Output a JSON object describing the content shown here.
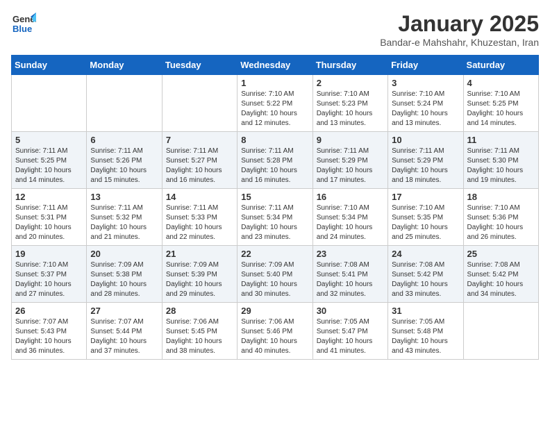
{
  "header": {
    "logo_general": "General",
    "logo_blue": "Blue",
    "month_title": "January 2025",
    "subtitle": "Bandar-e Mahshahr, Khuzestan, Iran"
  },
  "weekdays": [
    "Sunday",
    "Monday",
    "Tuesday",
    "Wednesday",
    "Thursday",
    "Friday",
    "Saturday"
  ],
  "weeks": [
    [
      {
        "day": "",
        "info": ""
      },
      {
        "day": "",
        "info": ""
      },
      {
        "day": "",
        "info": ""
      },
      {
        "day": "1",
        "info": "Sunrise: 7:10 AM\nSunset: 5:22 PM\nDaylight: 10 hours\nand 12 minutes."
      },
      {
        "day": "2",
        "info": "Sunrise: 7:10 AM\nSunset: 5:23 PM\nDaylight: 10 hours\nand 13 minutes."
      },
      {
        "day": "3",
        "info": "Sunrise: 7:10 AM\nSunset: 5:24 PM\nDaylight: 10 hours\nand 13 minutes."
      },
      {
        "day": "4",
        "info": "Sunrise: 7:10 AM\nSunset: 5:25 PM\nDaylight: 10 hours\nand 14 minutes."
      }
    ],
    [
      {
        "day": "5",
        "info": "Sunrise: 7:11 AM\nSunset: 5:25 PM\nDaylight: 10 hours\nand 14 minutes."
      },
      {
        "day": "6",
        "info": "Sunrise: 7:11 AM\nSunset: 5:26 PM\nDaylight: 10 hours\nand 15 minutes."
      },
      {
        "day": "7",
        "info": "Sunrise: 7:11 AM\nSunset: 5:27 PM\nDaylight: 10 hours\nand 16 minutes."
      },
      {
        "day": "8",
        "info": "Sunrise: 7:11 AM\nSunset: 5:28 PM\nDaylight: 10 hours\nand 16 minutes."
      },
      {
        "day": "9",
        "info": "Sunrise: 7:11 AM\nSunset: 5:29 PM\nDaylight: 10 hours\nand 17 minutes."
      },
      {
        "day": "10",
        "info": "Sunrise: 7:11 AM\nSunset: 5:29 PM\nDaylight: 10 hours\nand 18 minutes."
      },
      {
        "day": "11",
        "info": "Sunrise: 7:11 AM\nSunset: 5:30 PM\nDaylight: 10 hours\nand 19 minutes."
      }
    ],
    [
      {
        "day": "12",
        "info": "Sunrise: 7:11 AM\nSunset: 5:31 PM\nDaylight: 10 hours\nand 20 minutes."
      },
      {
        "day": "13",
        "info": "Sunrise: 7:11 AM\nSunset: 5:32 PM\nDaylight: 10 hours\nand 21 minutes."
      },
      {
        "day": "14",
        "info": "Sunrise: 7:11 AM\nSunset: 5:33 PM\nDaylight: 10 hours\nand 22 minutes."
      },
      {
        "day": "15",
        "info": "Sunrise: 7:11 AM\nSunset: 5:34 PM\nDaylight: 10 hours\nand 23 minutes."
      },
      {
        "day": "16",
        "info": "Sunrise: 7:10 AM\nSunset: 5:34 PM\nDaylight: 10 hours\nand 24 minutes."
      },
      {
        "day": "17",
        "info": "Sunrise: 7:10 AM\nSunset: 5:35 PM\nDaylight: 10 hours\nand 25 minutes."
      },
      {
        "day": "18",
        "info": "Sunrise: 7:10 AM\nSunset: 5:36 PM\nDaylight: 10 hours\nand 26 minutes."
      }
    ],
    [
      {
        "day": "19",
        "info": "Sunrise: 7:10 AM\nSunset: 5:37 PM\nDaylight: 10 hours\nand 27 minutes."
      },
      {
        "day": "20",
        "info": "Sunrise: 7:09 AM\nSunset: 5:38 PM\nDaylight: 10 hours\nand 28 minutes."
      },
      {
        "day": "21",
        "info": "Sunrise: 7:09 AM\nSunset: 5:39 PM\nDaylight: 10 hours\nand 29 minutes."
      },
      {
        "day": "22",
        "info": "Sunrise: 7:09 AM\nSunset: 5:40 PM\nDaylight: 10 hours\nand 30 minutes."
      },
      {
        "day": "23",
        "info": "Sunrise: 7:08 AM\nSunset: 5:41 PM\nDaylight: 10 hours\nand 32 minutes."
      },
      {
        "day": "24",
        "info": "Sunrise: 7:08 AM\nSunset: 5:42 PM\nDaylight: 10 hours\nand 33 minutes."
      },
      {
        "day": "25",
        "info": "Sunrise: 7:08 AM\nSunset: 5:42 PM\nDaylight: 10 hours\nand 34 minutes."
      }
    ],
    [
      {
        "day": "26",
        "info": "Sunrise: 7:07 AM\nSunset: 5:43 PM\nDaylight: 10 hours\nand 36 minutes."
      },
      {
        "day": "27",
        "info": "Sunrise: 7:07 AM\nSunset: 5:44 PM\nDaylight: 10 hours\nand 37 minutes."
      },
      {
        "day": "28",
        "info": "Sunrise: 7:06 AM\nSunset: 5:45 PM\nDaylight: 10 hours\nand 38 minutes."
      },
      {
        "day": "29",
        "info": "Sunrise: 7:06 AM\nSunset: 5:46 PM\nDaylight: 10 hours\nand 40 minutes."
      },
      {
        "day": "30",
        "info": "Sunrise: 7:05 AM\nSunset: 5:47 PM\nDaylight: 10 hours\nand 41 minutes."
      },
      {
        "day": "31",
        "info": "Sunrise: 7:05 AM\nSunset: 5:48 PM\nDaylight: 10 hours\nand 43 minutes."
      },
      {
        "day": "",
        "info": ""
      }
    ]
  ]
}
